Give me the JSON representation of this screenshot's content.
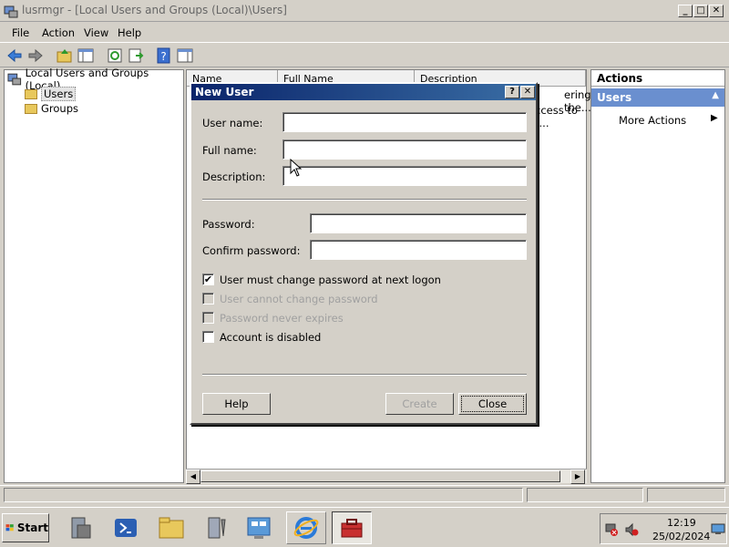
{
  "window": {
    "title": "lusrmgr - [Local Users and Groups (Local)\\Users]"
  },
  "menu": [
    "File",
    "Action",
    "View",
    "Help"
  ],
  "tree": {
    "root": "Local Users and Groups (Local)",
    "items": [
      "Users",
      "Groups"
    ],
    "selected": "Users"
  },
  "list": {
    "columns": [
      "Name",
      "Full Name",
      "Description"
    ],
    "rows": [
      {
        "description": "ering the..."
      },
      {
        "description": "ccess to t..."
      }
    ]
  },
  "actions": {
    "header": "Actions",
    "section": "Users",
    "items": [
      "More Actions"
    ]
  },
  "dialog": {
    "title": "New User",
    "help_glyph": "?",
    "fields": {
      "username_label": "User name:",
      "fullname_label": "Full name:",
      "description_label": "Description:",
      "password_label": "Password:",
      "confirm_label": "Confirm password:",
      "username_value": "",
      "fullname_value": "",
      "description_value": "",
      "password_value": "",
      "confirm_value": ""
    },
    "checkboxes": [
      {
        "label": "User must change password at next logon",
        "checked": true,
        "enabled": true
      },
      {
        "label": "User cannot change password",
        "checked": false,
        "enabled": false
      },
      {
        "label": "Password never expires",
        "checked": false,
        "enabled": false
      },
      {
        "label": "Account is disabled",
        "checked": false,
        "enabled": true
      }
    ],
    "buttons": {
      "help": "Help",
      "create": "Create",
      "close": "Close"
    }
  },
  "taskbar": {
    "start": "Start",
    "time": "12:19",
    "date": "25/02/2024"
  },
  "colors": {
    "titlebar_start": "#0a246a",
    "titlebar_end": "#3a6ea5",
    "actions_band": "#6a8fcf",
    "face": "#d4d0c8"
  }
}
